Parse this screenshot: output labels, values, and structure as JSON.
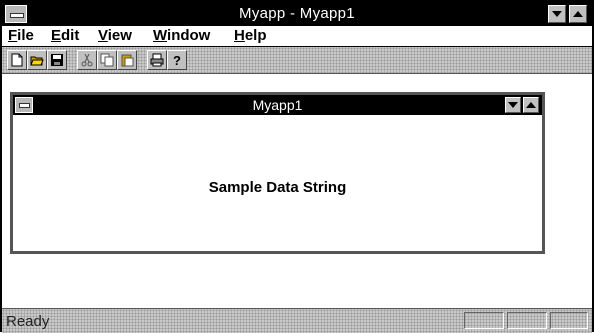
{
  "app": {
    "title": "Myapp - Myapp1"
  },
  "menu": {
    "items": [
      "File",
      "Edit",
      "View",
      "Window",
      "Help"
    ]
  },
  "toolbar": {
    "buttons": [
      "new-icon",
      "open-icon",
      "save-icon",
      "cut-icon",
      "copy-icon",
      "paste-icon",
      "print-icon",
      "help-icon"
    ]
  },
  "document": {
    "title": "Myapp1",
    "content": "Sample Data String"
  },
  "status": {
    "text": "Ready"
  }
}
